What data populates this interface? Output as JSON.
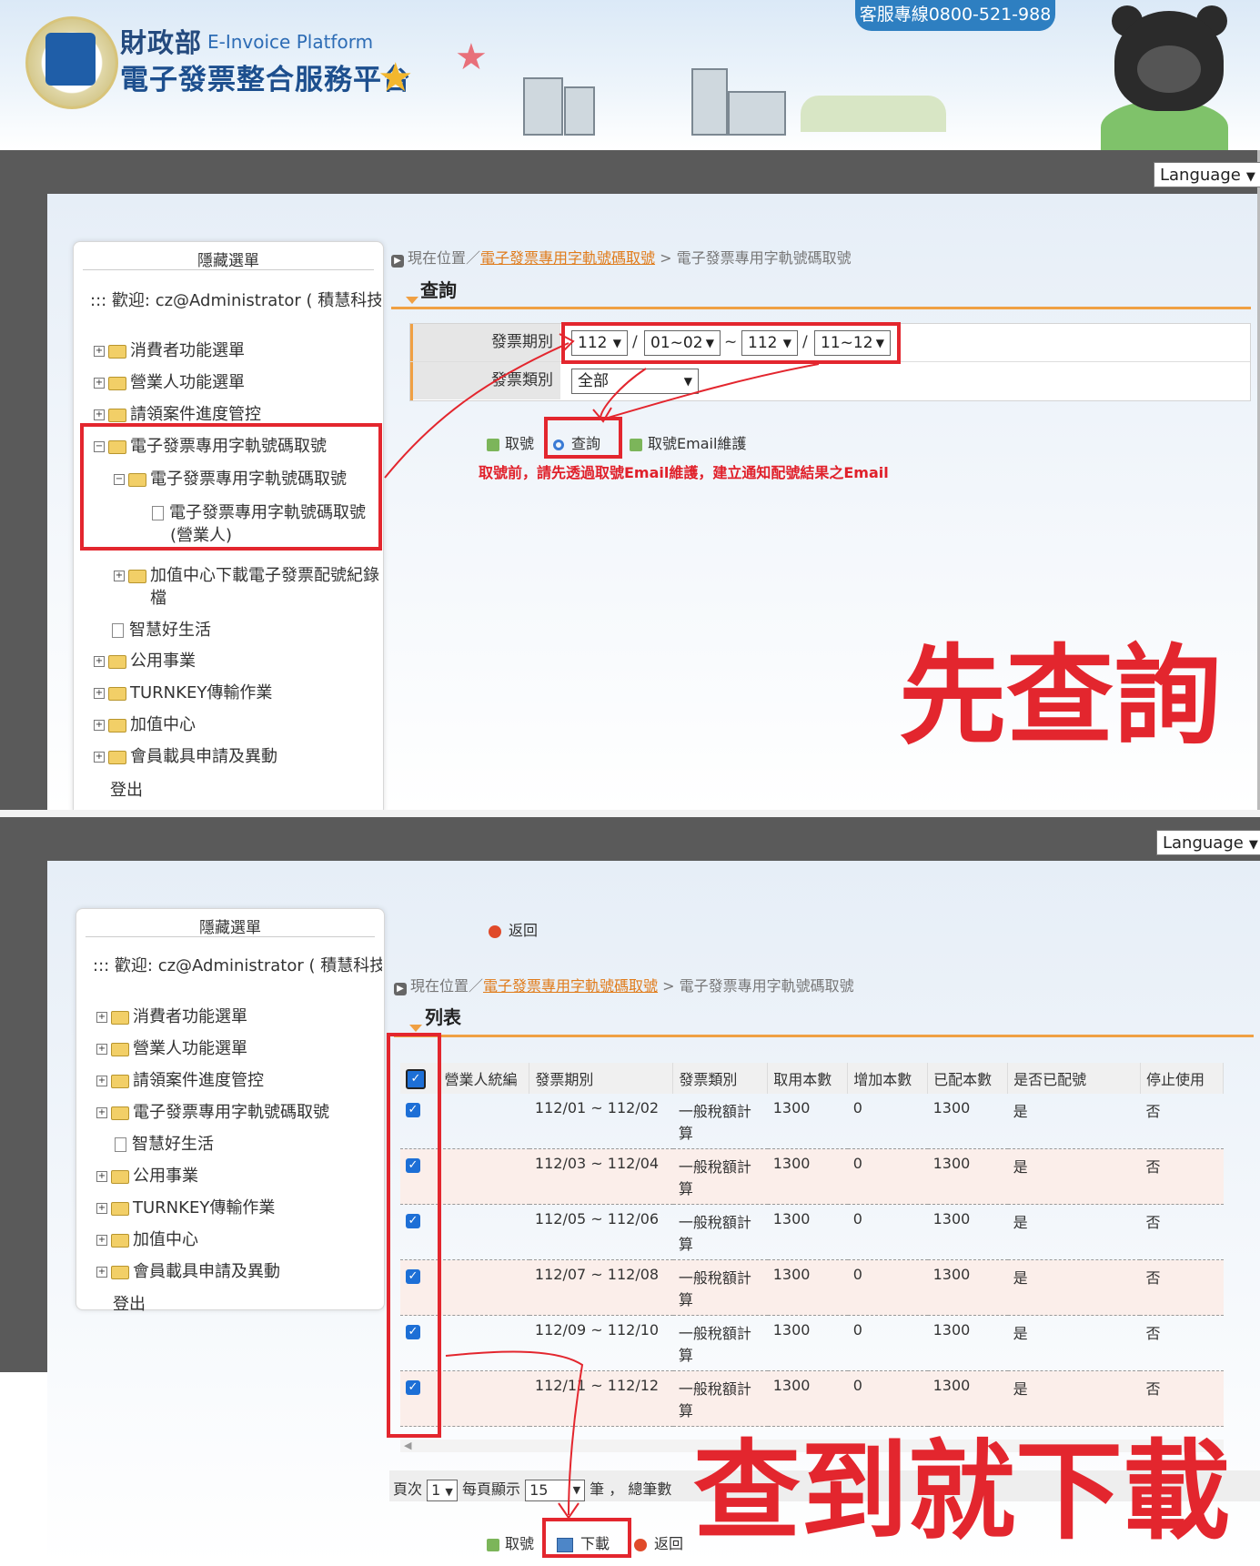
{
  "header": {
    "ministry": "財政部",
    "platform_en": "E-Invoice Platform",
    "platform_cn": "電子發票整合服務平台",
    "hotline": "客服專線0800-521-988"
  },
  "top": {
    "language": "Language",
    "menu_toggle": "隱藏選單",
    "welcome": "::: 歡迎: cz@Administrator ( 積慧科技@",
    "menu": [
      "消費者功能選單",
      "營業人功能選單",
      "請領案件進度管控",
      "電子發票專用字軌號碼取號",
      "電子發票專用字軌號碼取號",
      "電子發票專用字軌號碼取號",
      "(營業人)",
      "加值中心下載電子發票配號紀錄",
      "檔",
      "智慧好生活",
      "公用事業",
      "TURNKEY傳輸作業",
      "加值中心",
      "會員載具申請及異動",
      "登出"
    ],
    "breadcrumb": {
      "prefix": "現在位置／",
      "link": "電子發票專用字軌號碼取號",
      "sep": " > ",
      "current": "電子發票專用字軌號碼取號"
    },
    "section_title": "查詢",
    "form": {
      "period_label": "發票期別",
      "year_from": "112",
      "month_from": "01~02",
      "tilde": "~",
      "slash": "/",
      "year_to": "112",
      "month_to": "11~12",
      "type_label": "發票類別",
      "type_value": "全部"
    },
    "buttons": {
      "take": "取號",
      "query": "查詢",
      "email": "取號Email維護"
    },
    "notice": "取號前，請先透過取號Email維護，建立通知配號結果之Email",
    "annotation": "先查詢"
  },
  "bottom": {
    "language": "Language",
    "menu_toggle": "隱藏選單",
    "welcome": "::: 歡迎: cz@Administrator ( 積慧科技@",
    "menu": [
      "消費者功能選單",
      "營業人功能選單",
      "請領案件進度管控",
      "電子發票專用字軌號碼取號",
      "智慧好生活",
      "公用事業",
      "TURNKEY傳輸作業",
      "加值中心",
      "會員載具申請及異動",
      "登出"
    ],
    "back": "返回",
    "breadcrumb": {
      "prefix": "現在位置／",
      "link": "電子發票專用字軌號碼取號",
      "sep": " > ",
      "current": "電子發票專用字軌號碼取號"
    },
    "section_title": "列表",
    "table": {
      "headers": [
        "營業人統編",
        "發票期別",
        "發票類別",
        "取用本數",
        "增加本數",
        "已配本數",
        "是否已配號",
        "停止使用"
      ],
      "rows": [
        {
          "period": "112/01 ~ 112/02",
          "type": "一般稅額計算",
          "take": "1300",
          "add": "0",
          "assigned": "1300",
          "done": "是",
          "stop": "否"
        },
        {
          "period": "112/03 ~ 112/04",
          "type": "一般稅額計算",
          "take": "1300",
          "add": "0",
          "assigned": "1300",
          "done": "是",
          "stop": "否"
        },
        {
          "period": "112/05 ~ 112/06",
          "type": "一般稅額計算",
          "take": "1300",
          "add": "0",
          "assigned": "1300",
          "done": "是",
          "stop": "否"
        },
        {
          "period": "112/07 ~ 112/08",
          "type": "一般稅額計算",
          "take": "1300",
          "add": "0",
          "assigned": "1300",
          "done": "是",
          "stop": "否"
        },
        {
          "period": "112/09 ~ 112/10",
          "type": "一般稅額計算",
          "take": "1300",
          "add": "0",
          "assigned": "1300",
          "done": "是",
          "stop": "否"
        },
        {
          "period": "112/11 ~ 112/12",
          "type": "一般稅額計算",
          "take": "1300",
          "add": "0",
          "assigned": "1300",
          "done": "是",
          "stop": "否"
        }
      ]
    },
    "pager": {
      "page_label": "頁次",
      "page_value": "1",
      "per_page_label": "每頁顯示",
      "per_page_value": "15",
      "unit": "筆",
      "comma": "，",
      "total_label": "總筆數"
    },
    "buttons": {
      "take": "取號",
      "download": "下載",
      "back": "返回"
    },
    "annotation": "查到就下載"
  },
  "colors": {
    "annotation_red": "#e3262e",
    "accent_orange": "#f0a043",
    "checkbox_blue": "#1d6fd6"
  }
}
